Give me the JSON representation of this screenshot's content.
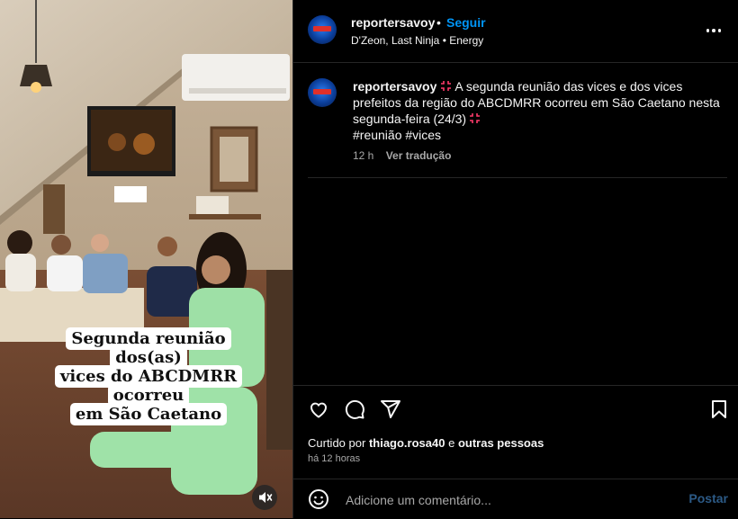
{
  "colors": {
    "accent": "#0095f6",
    "bg": "#000000",
    "muted": "#a8a8a8",
    "post_disabled": "#2c5a86"
  },
  "header": {
    "username": "reportersavoy",
    "separator": "•",
    "follow_label": "Seguir",
    "audio": "D'Zeon, Last Ninja",
    "audio_separator": "•",
    "audio_track": "Energy",
    "more_icon": "more-horizontal-icon"
  },
  "caption": {
    "username": "reportersavoy",
    "text": "A segunda reunião das vices e dos vices prefeitos da região do ABCDMRR ocorreu em São Caetano nesta segunda-feira (24/3)",
    "hashtags": "#reunião #vices",
    "time": "12 h",
    "translate_label": "Ver tradução",
    "emoji_icon": "anger-symbol-icon"
  },
  "video": {
    "overlay_line1": "Segunda reunião dos(as)",
    "overlay_line2": "vices do ABCDMRR ocorreu",
    "overlay_line3": "em São Caetano",
    "mute_icon": "speaker-muted-icon"
  },
  "actions": {
    "icons": [
      "heart-icon",
      "comment-icon",
      "share-icon",
      "bookmark-icon"
    ],
    "liked_prefix": "Curtido por",
    "liked_user": "thiago.rosa40",
    "liked_and": "e",
    "liked_others": "outras pessoas",
    "posted_time": "há 12 horas"
  },
  "comment": {
    "placeholder": "Adicione um comentário...",
    "post_label": "Postar",
    "emoji_icon": "smiley-icon"
  }
}
